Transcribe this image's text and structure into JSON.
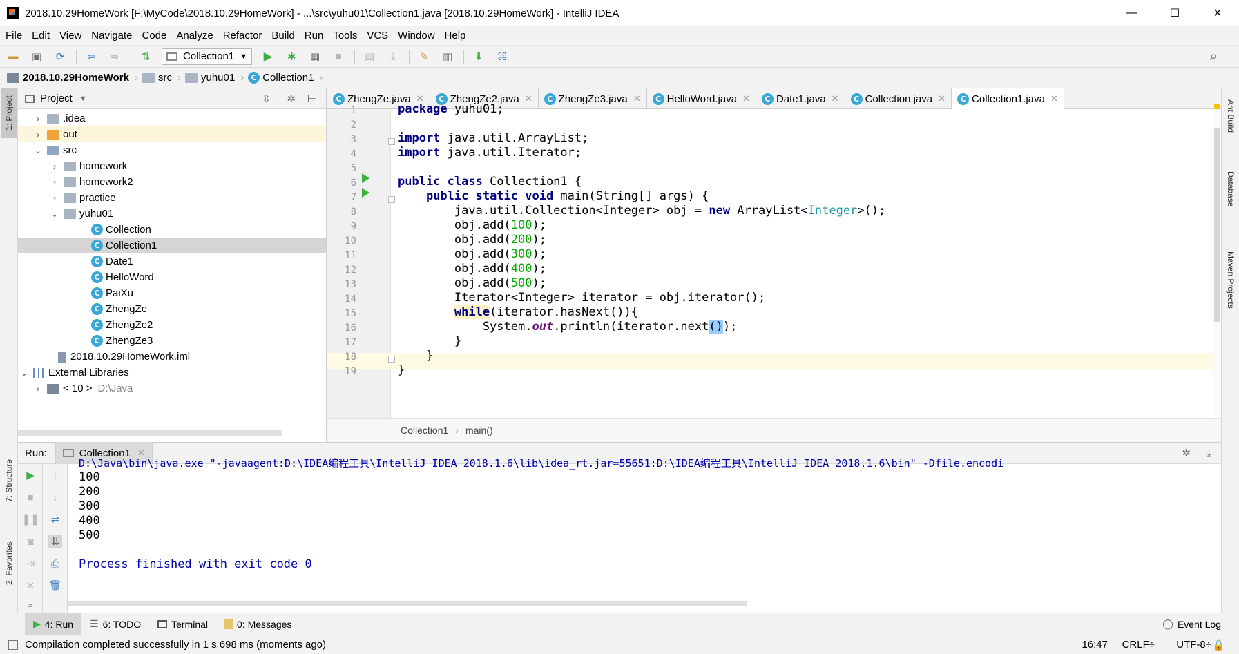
{
  "window": {
    "title": "2018.10.29HomeWork [F:\\MyCode\\2018.10.29HomeWork] - ...\\src\\yuhu01\\Collection1.java [2018.10.29HomeWork] - IntelliJ IDEA",
    "minimize": "—",
    "maximize": "☐",
    "close": "✕"
  },
  "menu": [
    "File",
    "Edit",
    "View",
    "Navigate",
    "Code",
    "Analyze",
    "Refactor",
    "Build",
    "Run",
    "Tools",
    "VCS",
    "Window",
    "Help"
  ],
  "toolbar": {
    "run_config": "Collection1"
  },
  "breadcrumb": [
    "2018.10.29HomeWork",
    "src",
    "yuhu01",
    "Collection1"
  ],
  "left_strip": {
    "project": "1: Project",
    "structure": "7: Structure",
    "favorites": "2: Favorites"
  },
  "right_strip": {
    "ant": "Ant Build",
    "database": "Database",
    "maven": "Maven Projects"
  },
  "project": {
    "header": "Project",
    "tree": [
      {
        "label": ".idea",
        "icon": "folder",
        "arrow": "›"
      },
      {
        "label": "out",
        "icon": "folder-orange",
        "arrow": "›"
      },
      {
        "label": "src",
        "icon": "folder",
        "arrow": "⌄"
      },
      {
        "label": "homework",
        "icon": "package",
        "arrow": "›"
      },
      {
        "label": "homework2",
        "icon": "package",
        "arrow": "›"
      },
      {
        "label": "practice",
        "icon": "package",
        "arrow": "›"
      },
      {
        "label": "yuhu01",
        "icon": "package",
        "arrow": "⌄"
      },
      {
        "label": "Collection",
        "icon": "class"
      },
      {
        "label": "Collection1",
        "icon": "class"
      },
      {
        "label": "Date1",
        "icon": "class"
      },
      {
        "label": "HelloWord",
        "icon": "class"
      },
      {
        "label": "PaiXu",
        "icon": "class"
      },
      {
        "label": "ZhengZe",
        "icon": "class"
      },
      {
        "label": "ZhengZe2",
        "icon": "class"
      },
      {
        "label": "ZhengZe3",
        "icon": "class"
      },
      {
        "label": "2018.10.29HomeWork.iml",
        "icon": "file"
      },
      {
        "label": "External Libraries",
        "icon": "library",
        "arrow": "⌄"
      },
      {
        "label": "< 10 >",
        "suffix": "D:\\Java",
        "icon": "sdk",
        "arrow": "›"
      }
    ]
  },
  "tabs": [
    {
      "label": "ZhengZe.java"
    },
    {
      "label": "ZhengZe2.java"
    },
    {
      "label": "ZhengZe3.java"
    },
    {
      "label": "HelloWord.java"
    },
    {
      "label": "Date1.java"
    },
    {
      "label": "Collection.java"
    },
    {
      "label": "Collection1.java",
      "active": true
    }
  ],
  "editor": {
    "line_numbers": [
      "1",
      "2",
      "3",
      "4",
      "5",
      "6",
      "7",
      "8",
      "9",
      "10",
      "11",
      "12",
      "13",
      "14",
      "15",
      "16",
      "17",
      "18",
      "19"
    ],
    "crumbs": [
      "Collection1",
      "main()"
    ]
  },
  "run_panel": {
    "label": "Run:",
    "tab": "Collection1",
    "console": [
      "D:\\Java\\bin\\java.exe \"-javaagent:D:\\IDEA编程工具\\IntelliJ IDEA 2018.1.6\\lib\\idea_rt.jar=55651:D:\\IDEA编程工具\\IntelliJ IDEA 2018.1.6\\bin\" -Dfile.encodi",
      "100",
      "200",
      "300",
      "400",
      "500",
      "",
      "Process finished with exit code 0"
    ]
  },
  "bottom_tabs": [
    "4: Run",
    "6: TODO",
    "Terminal",
    "0: Messages"
  ],
  "event_log": "Event Log",
  "status": {
    "message": "Compilation completed successfully in 1 s 698 ms (moments ago)",
    "position": "16:47",
    "line_sep": "CRLF÷",
    "encoding": "UTF-8÷"
  },
  "colors": {
    "keyword": "#000080",
    "number": "#0000ff",
    "field": "#660e7a",
    "current_line": "#fffae3"
  }
}
